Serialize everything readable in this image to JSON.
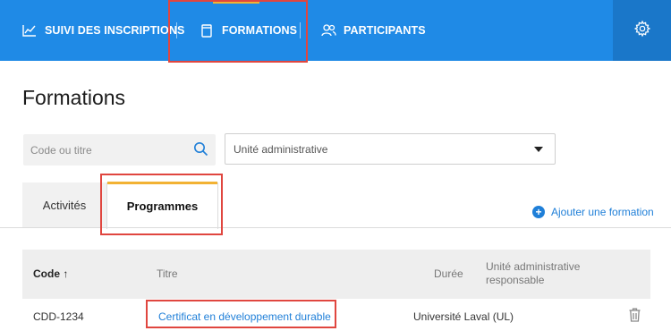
{
  "nav": {
    "items": [
      {
        "label": "SUIVI DES INSCRIPTIONS",
        "icon": "chart-line-icon"
      },
      {
        "label": "FORMATIONS",
        "icon": "book-icon",
        "active": true
      },
      {
        "label": "PARTICIPANTS",
        "icon": "users-icon"
      }
    ],
    "settings_icon": "gear-icon",
    "accent_color": "#f2b233",
    "bar_color": "#1f8ae6"
  },
  "page": {
    "title": "Formations"
  },
  "filters": {
    "search_placeholder": "Code ou titre",
    "search_value": "",
    "unit_select": {
      "selected": "Unité administrative"
    }
  },
  "tabs": [
    {
      "label": "Activités",
      "active": false
    },
    {
      "label": "Programmes",
      "active": true
    }
  ],
  "actions": {
    "add_label": "Ajouter une formation",
    "add_icon": "plus-circle-icon"
  },
  "table": {
    "columns": [
      {
        "label": "Code ↑",
        "sorted": "asc"
      },
      {
        "label": "Titre"
      },
      {
        "label": "Durée"
      },
      {
        "label_line1": "Unité administrative",
        "label_line2": "responsable"
      }
    ],
    "rows": [
      {
        "code": "CDD-1234",
        "title": "Certificat en développement durable",
        "duration": "",
        "unit": "Université Laval (UL)",
        "delete_icon": "trash-icon"
      }
    ]
  }
}
